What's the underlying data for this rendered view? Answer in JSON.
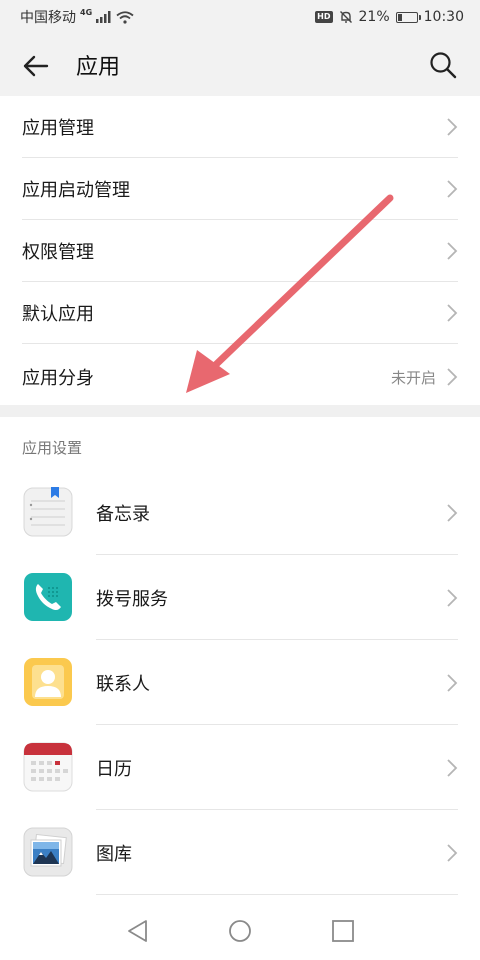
{
  "status_bar": {
    "carrier": "中国移动",
    "network": "4G",
    "battery": "21%",
    "battery_level": 0.21,
    "time": "10:30",
    "hd": "HD"
  },
  "app_bar": {
    "title": "应用"
  },
  "menu": [
    {
      "label": "应用管理",
      "value": ""
    },
    {
      "label": "应用启动管理",
      "value": ""
    },
    {
      "label": "权限管理",
      "value": ""
    },
    {
      "label": "默认应用",
      "value": ""
    },
    {
      "label": "应用分身",
      "value": "未开启"
    }
  ],
  "section_title": "应用设置",
  "apps": [
    {
      "label": "备忘录",
      "icon": "notepad-icon"
    },
    {
      "label": "拨号服务",
      "icon": "phone-icon"
    },
    {
      "label": "联系人",
      "icon": "contacts-icon"
    },
    {
      "label": "日历",
      "icon": "calendar-icon"
    },
    {
      "label": "图库",
      "icon": "gallery-icon"
    }
  ],
  "colors": {
    "annotation_arrow": "#e8686f",
    "dialer": "#1fb6b0",
    "contacts": "#fbc94e",
    "calendar_top": "#c8323c"
  }
}
